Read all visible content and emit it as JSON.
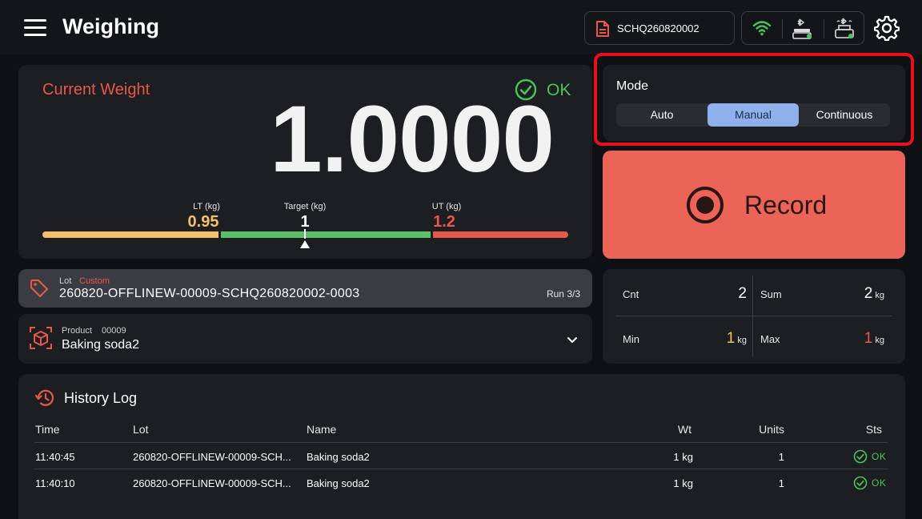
{
  "header": {
    "title": "Weighing",
    "document_id": "SCHQ260820002"
  },
  "weight": {
    "label": "Current Weight",
    "status": "OK",
    "value": "1.0000",
    "lt_label": "LT (kg)",
    "lt_value": "0.95",
    "target_label": "Target (kg)",
    "target_value": "1",
    "ut_label": "UT (kg)",
    "ut_value": "1.2"
  },
  "mode": {
    "label": "Mode",
    "options": [
      "Auto",
      "Manual",
      "Continuous"
    ],
    "selected": "Manual"
  },
  "record": {
    "label": "Record"
  },
  "lot": {
    "label": "Lot",
    "tag": "Custom",
    "value": "260820-OFFLINEW-00009-SCHQ260820002-0003",
    "run": "Run 3/3"
  },
  "product": {
    "label": "Product",
    "code": "00009",
    "name": "Baking soda2"
  },
  "stats": {
    "cnt_label": "Cnt",
    "cnt_value": "2",
    "sum_label": "Sum",
    "sum_value": "2",
    "sum_unit": "kg",
    "min_label": "Min",
    "min_value": "1",
    "min_unit": "kg",
    "max_label": "Max",
    "max_value": "1",
    "max_unit": "kg"
  },
  "history": {
    "title": "History Log",
    "columns": [
      "Time",
      "Lot",
      "Name",
      "Wt",
      "Units",
      "Sts"
    ],
    "rows": [
      {
        "time": "11:40:45",
        "lot": "260820-OFFLINEW-00009-SCH...",
        "name": "Baking soda2",
        "wt": "1 kg",
        "units": "1",
        "sts": "OK"
      },
      {
        "time": "11:40:10",
        "lot": "260820-OFFLINEW-00009-SCH...",
        "name": "Baking soda2",
        "wt": "1 kg",
        "units": "1",
        "sts": "OK"
      }
    ]
  },
  "colors": {
    "accent_red": "#e8574c",
    "ok_green": "#4cc35c",
    "record_bg": "#ec6358",
    "mode_active": "#8fb0ea",
    "bar_low": "#f6c06a",
    "bar_ok": "#5cc166",
    "bar_high": "#e8574c",
    "highlight_frame": "#e8101c"
  },
  "icons": {
    "menu": "hamburger-icon",
    "document": "document-icon",
    "wifi": "wifi-icon",
    "scale_bluetooth": "bluetooth-scale-icon",
    "printer_bluetooth": "bluetooth-printer-icon",
    "settings": "gear-icon",
    "status_ok": "check-circle-icon",
    "record": "record-icon",
    "lot": "tag-icon",
    "product": "box-icon",
    "expand": "chevron-down-icon",
    "history": "history-icon"
  }
}
